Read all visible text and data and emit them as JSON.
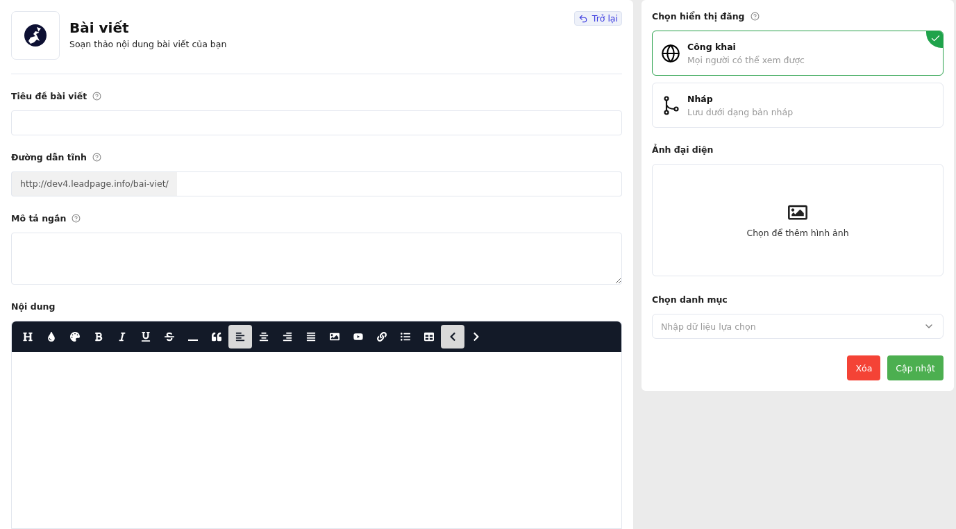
{
  "header": {
    "title": "Bài viết",
    "subtitle": "Soạn thảo nội dung bài viết của bạn",
    "back_button": "Trở lại"
  },
  "fields": [
    {
      "kind": "input",
      "label": "Tiêu đề bài viết",
      "help": true
    },
    {
      "kind": "prefixed",
      "label": "Đường dẫn tĩnh",
      "help": true,
      "prefix": "http://dev4.leadpage.info/bai-viet/"
    },
    {
      "kind": "textarea",
      "label": "Mô tả ngắn",
      "help": true
    }
  ],
  "editor": {
    "label": "Nội dung",
    "toolbar": [
      {
        "kind": "heading",
        "active": false
      },
      {
        "kind": "color",
        "active": false
      },
      {
        "kind": "palette",
        "active": false
      },
      {
        "kind": "bold",
        "active": false
      },
      {
        "kind": "italic",
        "active": false
      },
      {
        "kind": "underline",
        "active": false
      },
      {
        "kind": "strike",
        "active": false
      },
      {
        "kind": "rule",
        "active": false
      },
      {
        "kind": "quote",
        "active": false
      },
      {
        "kind": "align-left",
        "active": true
      },
      {
        "kind": "align-center",
        "active": false
      },
      {
        "kind": "align-right",
        "active": false
      },
      {
        "kind": "justify",
        "active": false
      },
      {
        "kind": "image",
        "active": false
      },
      {
        "kind": "video",
        "active": false
      },
      {
        "kind": "link",
        "active": false
      },
      {
        "kind": "list",
        "active": false
      },
      {
        "kind": "table",
        "active": false
      },
      {
        "kind": "prev",
        "active": true
      },
      {
        "kind": "next",
        "active": false
      }
    ]
  },
  "visibility": {
    "label": "Chọn hiển thị đăng",
    "options": [
      {
        "kind": "public",
        "title": "Công khai",
        "description": "Mọi người có thể xem được",
        "selected": true
      },
      {
        "kind": "draft",
        "title": "Nháp",
        "description": "Lưu dưới dạng bản nháp",
        "selected": false
      }
    ]
  },
  "thumbnail": {
    "label": "Ảnh đại diện",
    "hint": "Chọn để thêm hình ảnh"
  },
  "category": {
    "label": "Chọn danh mục",
    "placeholder": "Nhập dữ liệu lựa chọn"
  },
  "actions": [
    {
      "kind": "danger",
      "label": "Xóa"
    },
    {
      "kind": "primary",
      "label": "Cập nhật"
    }
  ]
}
